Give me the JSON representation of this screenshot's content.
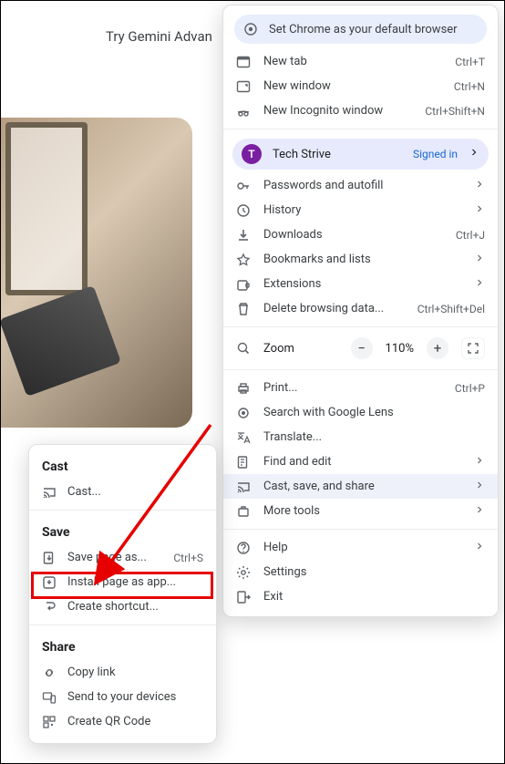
{
  "promo": {
    "text": "Try Gemini Advan"
  },
  "account": {
    "initial": "T",
    "name": "Tech Strive",
    "status": "Signed in"
  },
  "banner": {
    "label": "Set Chrome as your default browser"
  },
  "menu": {
    "new_tab": {
      "label": "New tab",
      "shortcut": "Ctrl+T"
    },
    "new_window": {
      "label": "New window",
      "shortcut": "Ctrl+N"
    },
    "incognito": {
      "label": "New Incognito window",
      "shortcut": "Ctrl+Shift+N"
    },
    "passwords": {
      "label": "Passwords and autofill"
    },
    "history": {
      "label": "History"
    },
    "downloads": {
      "label": "Downloads",
      "shortcut": "Ctrl+J"
    },
    "bookmarks": {
      "label": "Bookmarks and lists"
    },
    "extensions": {
      "label": "Extensions"
    },
    "clear": {
      "label": "Delete browsing data...",
      "shortcut": "Ctrl+Shift+Del"
    },
    "zoom": {
      "label": "Zoom",
      "value": "110%"
    },
    "print": {
      "label": "Print...",
      "shortcut": "Ctrl+P"
    },
    "lens": {
      "label": "Search with Google Lens"
    },
    "translate": {
      "label": "Translate..."
    },
    "find": {
      "label": "Find and edit"
    },
    "cast": {
      "label": "Cast, save, and share"
    },
    "more_tools": {
      "label": "More tools"
    },
    "help": {
      "label": "Help"
    },
    "settings": {
      "label": "Settings"
    },
    "exit": {
      "label": "Exit"
    }
  },
  "submenu": {
    "cast_header": "Cast",
    "cast": {
      "label": "Cast..."
    },
    "save_header": "Save",
    "save_page": {
      "label": "Save page as...",
      "shortcut": "Ctrl+S"
    },
    "install_app": {
      "label": "Install page as app..."
    },
    "shortcut": {
      "label": "Create shortcut..."
    },
    "share_header": "Share",
    "copy_link": {
      "label": "Copy link"
    },
    "send_devices": {
      "label": "Send to your devices"
    },
    "qr": {
      "label": "Create QR Code"
    }
  }
}
